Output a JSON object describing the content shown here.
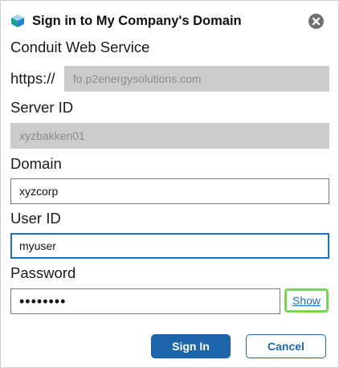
{
  "dialog": {
    "title": "Sign in to My Company's Domain",
    "logo_icon": "layered-cube-logo",
    "close_icon": "close-circle-icon"
  },
  "conduit": {
    "label": "Conduit Web Service",
    "prefix": "https://",
    "value": "fo.p2energysolutions.com"
  },
  "server": {
    "label": "Server ID",
    "value": "xyzbakken01"
  },
  "domain": {
    "label": "Domain",
    "value": "xyzcorp"
  },
  "user": {
    "label": "User ID",
    "value": "myuser"
  },
  "password": {
    "label": "Password",
    "value": "••••••••",
    "show_label": "Show"
  },
  "buttons": {
    "sign_in": "Sign In",
    "cancel": "Cancel"
  },
  "colors": {
    "accent": "#1e66ab",
    "highlight": "#7ad35a",
    "disabled_field": "#cccccc",
    "logo_teal": "#1aa39a",
    "logo_blue": "#2a7fcf"
  }
}
